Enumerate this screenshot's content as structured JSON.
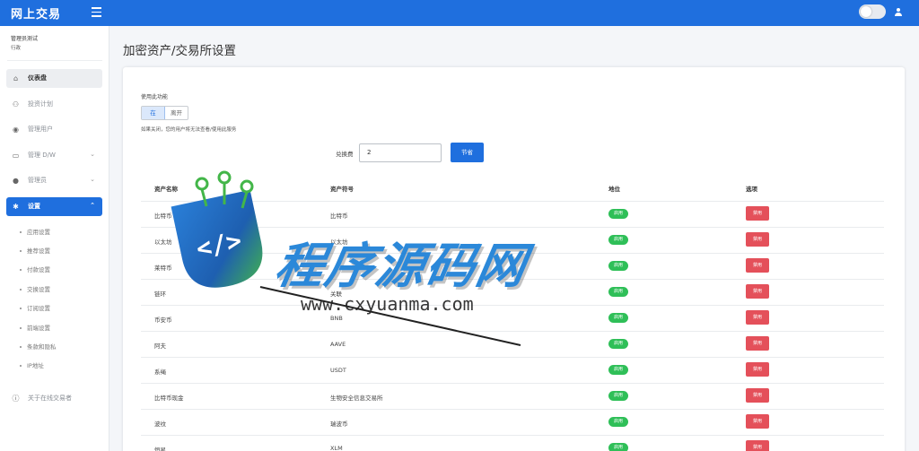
{
  "app": {
    "title": "网上交易"
  },
  "profile": {
    "name": "管理员测试",
    "role": "行政"
  },
  "sidebar": {
    "items": [
      {
        "label": "仪表盘"
      },
      {
        "label": "投资计划"
      },
      {
        "label": "管理用户"
      },
      {
        "label": "管理 D/W"
      },
      {
        "label": "管理员"
      },
      {
        "label": "设置"
      }
    ],
    "sub_items": [
      {
        "label": "应用设置"
      },
      {
        "label": "推荐设置"
      },
      {
        "label": "付款设置"
      },
      {
        "label": "交换设置"
      },
      {
        "label": "订阅设置"
      },
      {
        "label": "前端设置"
      },
      {
        "label": "条款和隐私"
      },
      {
        "label": "IP地址"
      }
    ],
    "about": "关于在线交易者"
  },
  "page": {
    "title": "加密资产/交易所设置"
  },
  "feature": {
    "label": "使用此功能",
    "on_label": "在",
    "off_label": "离开",
    "hint": "如果关闭，您的用户将无法查看/使用此服务"
  },
  "fee": {
    "label": "兑换费",
    "value": "2",
    "save_label": "节省"
  },
  "table": {
    "headers": [
      "资产名称",
      "资产符号",
      "地位",
      "选项"
    ],
    "rows": [
      {
        "name": "比特币",
        "symbol": "比特币",
        "status": "启用",
        "action": "禁用"
      },
      {
        "name": "以太坊",
        "symbol": "以太坊",
        "status": "启用",
        "action": "禁用"
      },
      {
        "name": "莱特币",
        "symbol": "",
        "status": "启用",
        "action": "禁用"
      },
      {
        "name": "链环",
        "symbol": "关联",
        "status": "启用",
        "action": "禁用"
      },
      {
        "name": "币安币",
        "symbol": "BNB",
        "status": "启用",
        "action": "禁用"
      },
      {
        "name": "阿夫",
        "symbol": "AAVE",
        "status": "启用",
        "action": "禁用"
      },
      {
        "name": "系绳",
        "symbol": "USDT",
        "status": "启用",
        "action": "禁用"
      },
      {
        "name": "比特币现金",
        "symbol": "生物安全信息交易所",
        "status": "启用",
        "action": "禁用"
      },
      {
        "name": "波纹",
        "symbol": "瑞波币",
        "status": "启用",
        "action": "禁用"
      },
      {
        "name": "恒星",
        "symbol": "XLM",
        "status": "启用",
        "action": "禁用"
      }
    ]
  },
  "watermark": {
    "text": "程序源码网",
    "url": "www.cxyuanma.com"
  },
  "colors": {
    "primary": "#1f6fde",
    "success": "#2fbf58",
    "danger": "#e4505a"
  }
}
